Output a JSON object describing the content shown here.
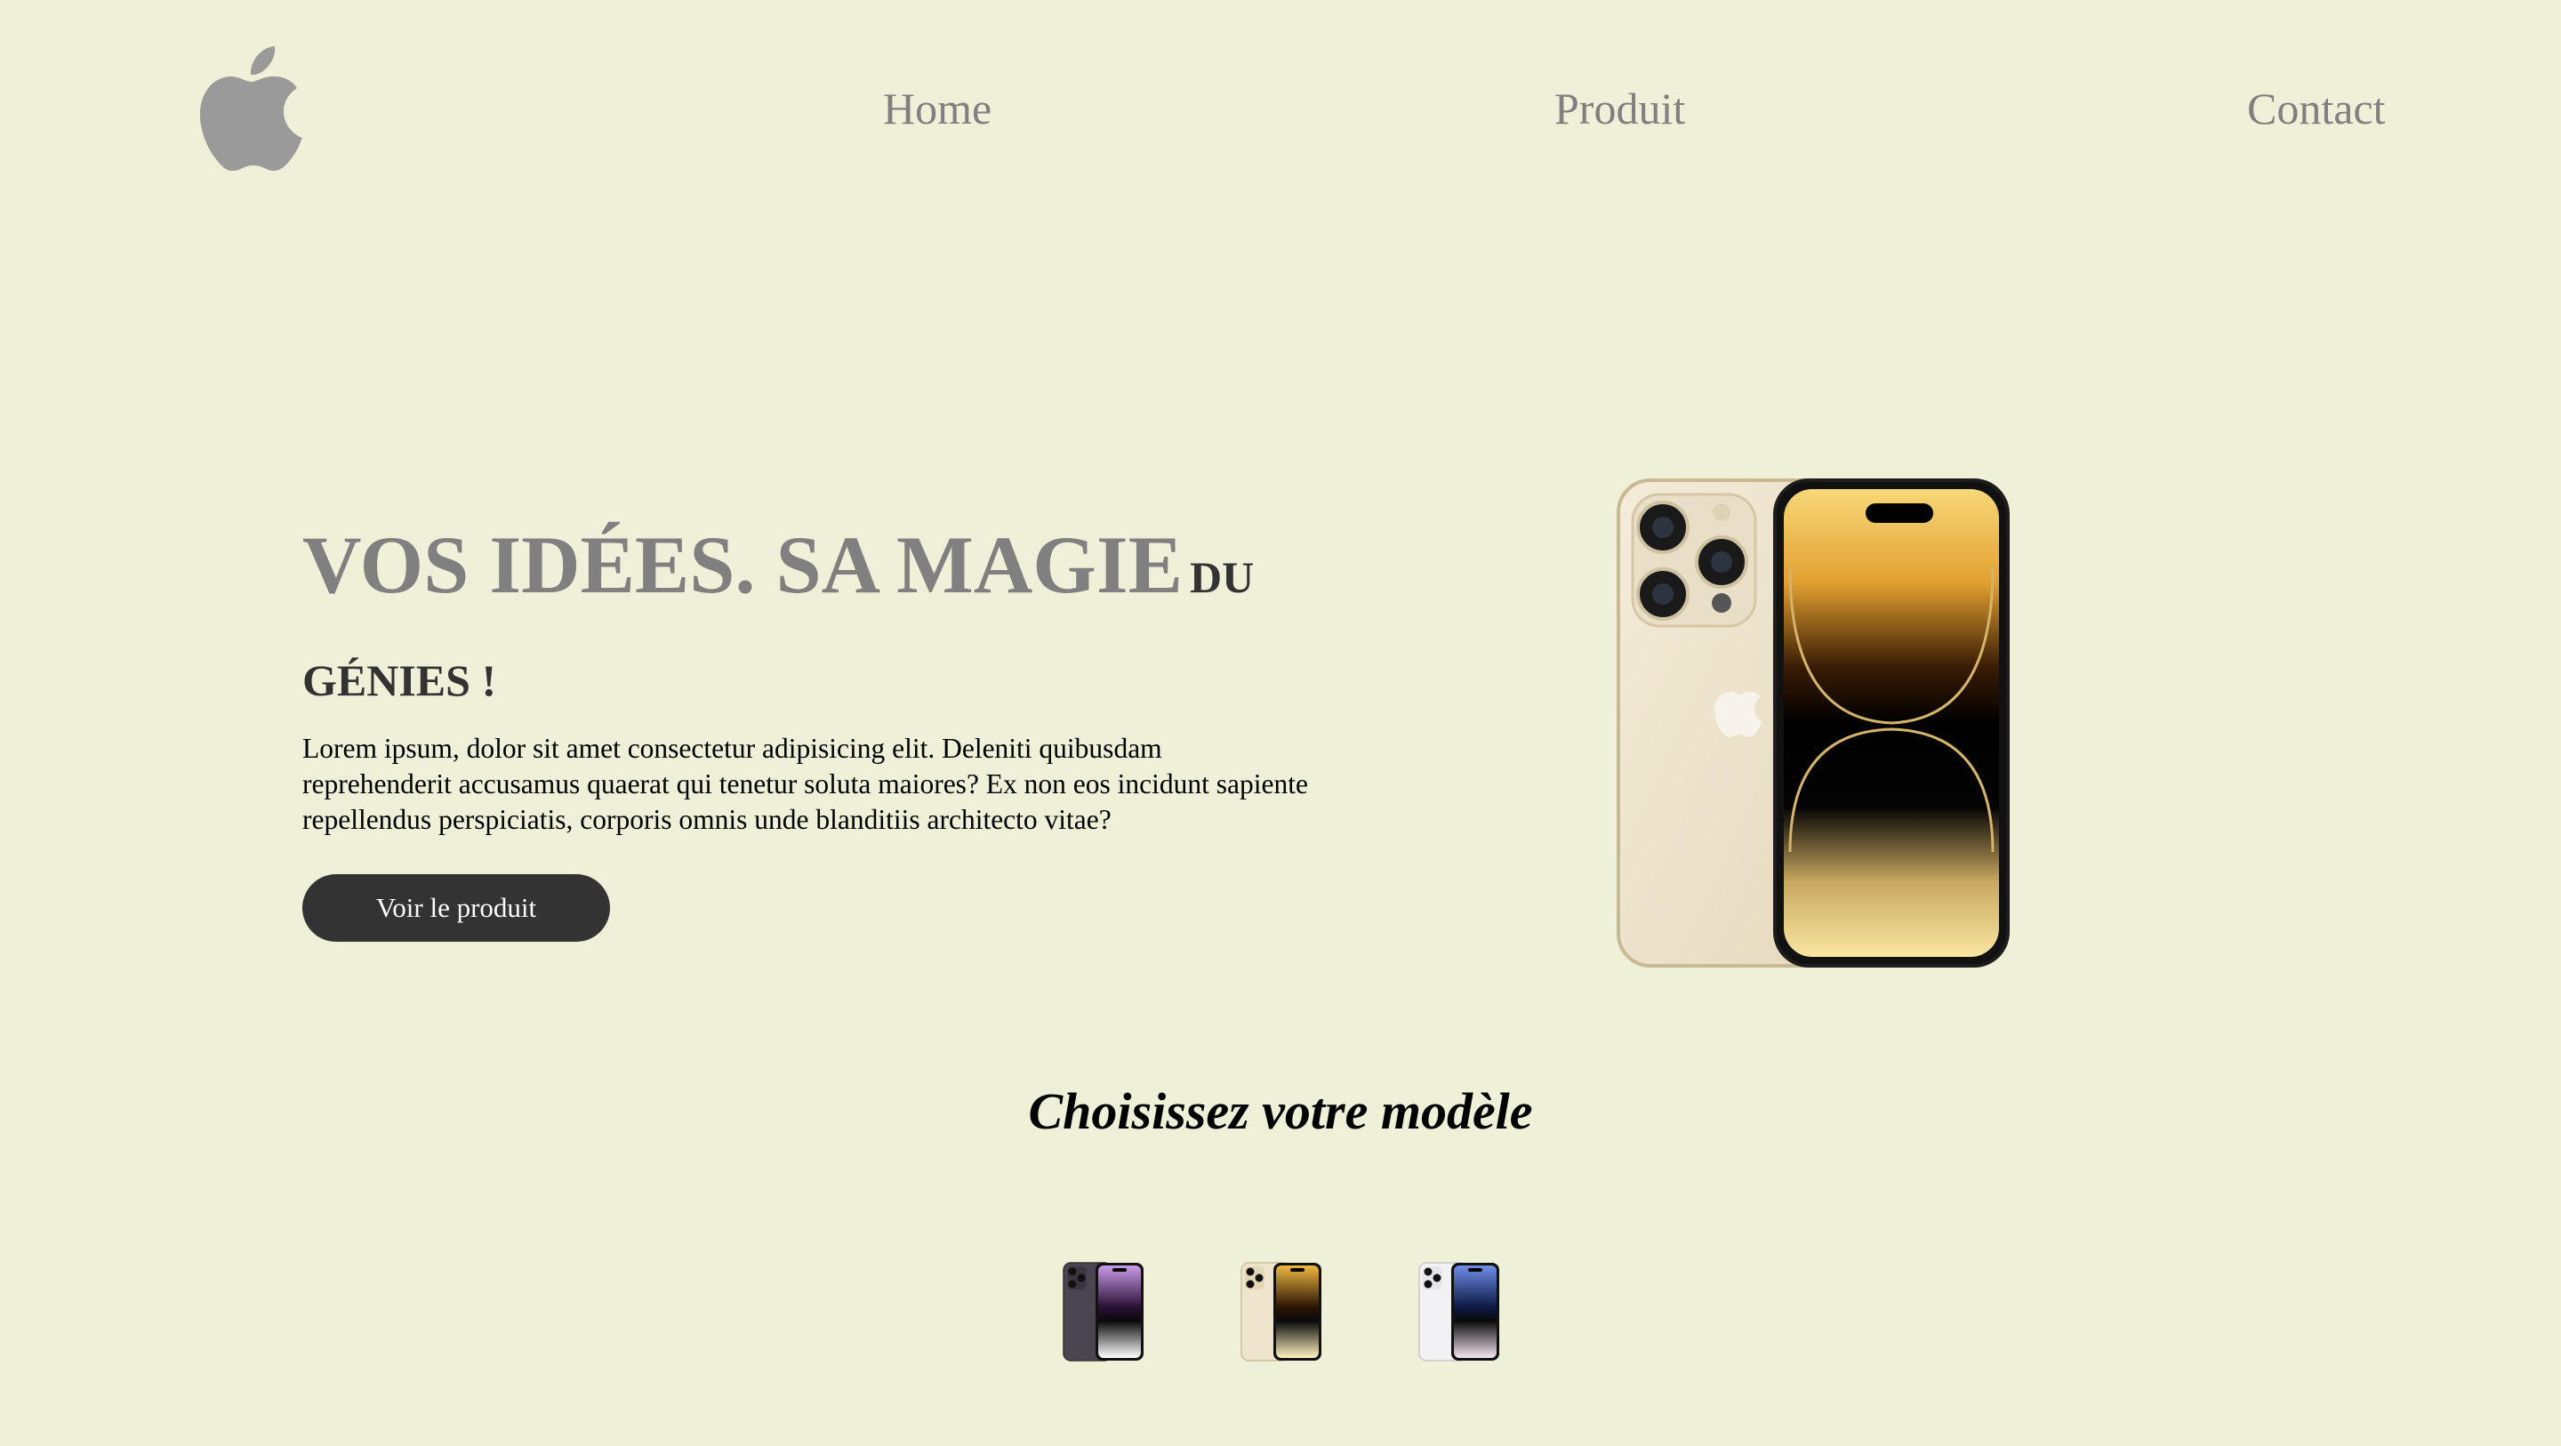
{
  "nav": {
    "logo_icon": "apple-logo-icon",
    "links": [
      "Home",
      "Produit",
      "Contact"
    ]
  },
  "hero": {
    "title_big": "VOS IDÉES. SA MAGIE",
    "title_small": "DU",
    "title_line2": "GÉNIES !",
    "text": "Lorem ipsum, dolor sit amet consectetur adipisicing elit. Deleniti quibusdam reprehenderit accusamus quaerat qui tenetur soluta maiores? Ex non eos incidunt sapiente repellendus perspiciatis, corporis omnis unde blanditiis architecto vitae?",
    "button_label": "Voir le produit",
    "image_icon": "iphone-gold-image"
  },
  "models": {
    "title": "Choisissez votre modèle",
    "items": [
      {
        "icon": "iphone-purple-thumbnail",
        "body": "#4a4550",
        "screen_top": "#c89be8",
        "screen_bottom": "#ffffff"
      },
      {
        "icon": "iphone-gold-thumbnail",
        "body": "#efe4cc",
        "screen_top": "#f0b840",
        "screen_bottom": "#fff2c0"
      },
      {
        "icon": "iphone-silver-thumbnail",
        "body": "#f2f2f4",
        "screen_top": "#6f8ee8",
        "screen_bottom": "#f4e6f0"
      }
    ]
  },
  "colors": {
    "background": "#eff0d8",
    "nav_text": "#808080",
    "dark": "#333333"
  }
}
